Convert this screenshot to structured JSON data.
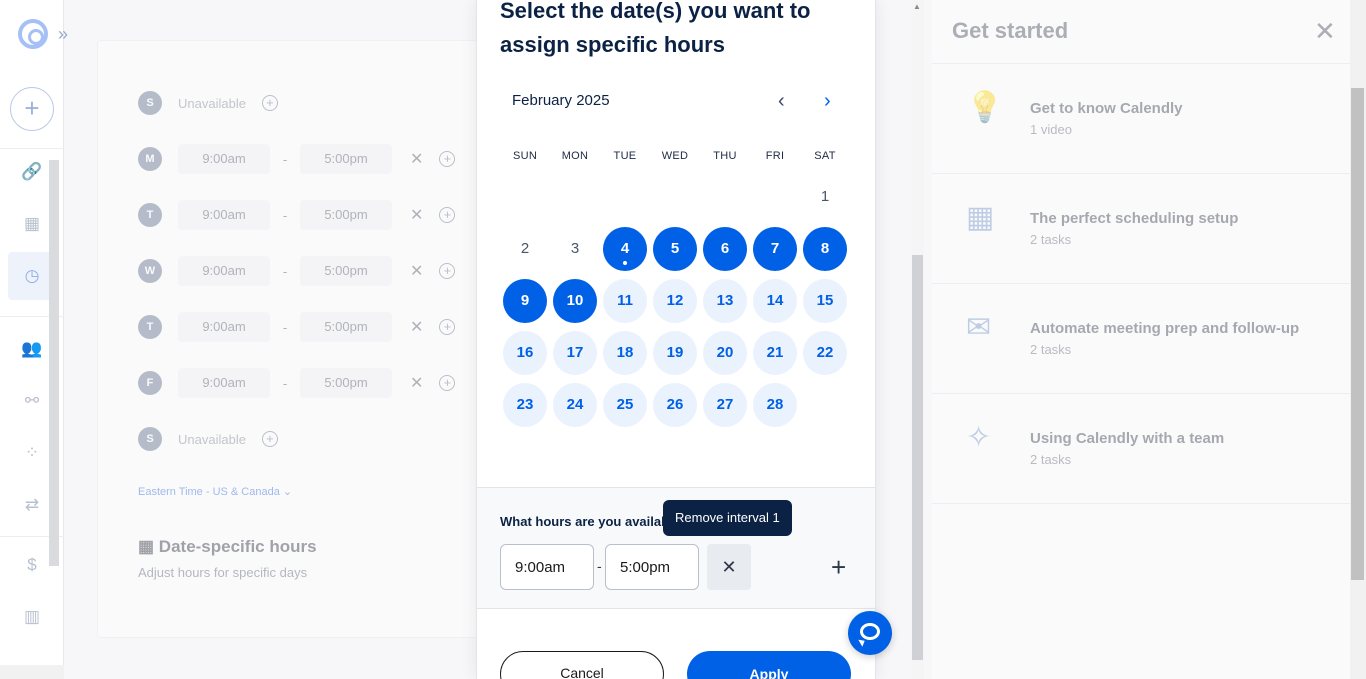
{
  "sidebar": {
    "create_label": "+",
    "items": [
      {
        "name": "scheduling-link-icon",
        "glyph": "🔗"
      },
      {
        "name": "meetings-calendar-icon",
        "glyph": "▦"
      },
      {
        "name": "availability-clock-icon",
        "glyph": "◷"
      },
      {
        "name": "contacts-icon",
        "glyph": "👥"
      },
      {
        "name": "workflows-icon",
        "glyph": "⚯"
      },
      {
        "name": "integrations-icon",
        "glyph": "⁘"
      },
      {
        "name": "routing-icon",
        "glyph": "⇄"
      },
      {
        "name": "billing-icon",
        "glyph": "$"
      },
      {
        "name": "analytics-icon",
        "glyph": "▥"
      }
    ]
  },
  "background": {
    "rows": [
      {
        "day": "S",
        "unavailable": "Unavailable"
      },
      {
        "day": "M",
        "start": "9:00am",
        "end": "5:00pm"
      },
      {
        "day": "T",
        "start": "9:00am",
        "end": "5:00pm"
      },
      {
        "day": "W",
        "start": "9:00am",
        "end": "5:00pm"
      },
      {
        "day": "T",
        "start": "9:00am",
        "end": "5:00pm"
      },
      {
        "day": "F",
        "start": "9:00am",
        "end": "5:00pm"
      },
      {
        "day": "S",
        "unavailable": "Unavailable"
      }
    ],
    "dash": "-",
    "timezone": "Eastern Time - US & Canada",
    "date_specific_title": "Date-specific hours",
    "date_specific_sub": "Adjust hours for specific days"
  },
  "modal": {
    "title": "Select the date(s) you want to assign specific hours",
    "month": "February 2025",
    "weekdays": [
      "SUN",
      "MON",
      "TUE",
      "WED",
      "THU",
      "FRI",
      "SAT"
    ],
    "days": [
      {
        "d": "1",
        "state": "plain"
      },
      {
        "d": "2",
        "state": "plain"
      },
      {
        "d": "3",
        "state": "plain"
      },
      {
        "d": "4",
        "state": "sel",
        "today": true
      },
      {
        "d": "5",
        "state": "sel"
      },
      {
        "d": "6",
        "state": "sel"
      },
      {
        "d": "7",
        "state": "sel"
      },
      {
        "d": "8",
        "state": "sel"
      },
      {
        "d": "9",
        "state": "sel"
      },
      {
        "d": "10",
        "state": "sel"
      },
      {
        "d": "11",
        "state": "avail"
      },
      {
        "d": "12",
        "state": "avail"
      },
      {
        "d": "13",
        "state": "avail"
      },
      {
        "d": "14",
        "state": "avail"
      },
      {
        "d": "15",
        "state": "avail"
      },
      {
        "d": "16",
        "state": "avail"
      },
      {
        "d": "17",
        "state": "avail"
      },
      {
        "d": "18",
        "state": "avail"
      },
      {
        "d": "19",
        "state": "avail"
      },
      {
        "d": "20",
        "state": "avail"
      },
      {
        "d": "21",
        "state": "avail"
      },
      {
        "d": "22",
        "state": "avail"
      },
      {
        "d": "23",
        "state": "avail"
      },
      {
        "d": "24",
        "state": "avail"
      },
      {
        "d": "25",
        "state": "avail"
      },
      {
        "d": "26",
        "state": "avail"
      },
      {
        "d": "27",
        "state": "avail"
      },
      {
        "d": "28",
        "state": "avail"
      }
    ],
    "hours_question": "What hours are you available?",
    "start_time": "9:00am",
    "end_time": "5:00pm",
    "dash": "-",
    "tooltip": "Remove interval 1",
    "cancel_label": "Cancel",
    "apply_label": "Apply"
  },
  "get_started": {
    "title": "Get started",
    "items": [
      {
        "name": "Get to know Calendly",
        "sub": "1 video",
        "icon": "lightbulb-icon"
      },
      {
        "name": "The perfect scheduling setup",
        "sub": "2 tasks",
        "icon": "calendar-grid-icon"
      },
      {
        "name": "Automate meeting prep and follow-up",
        "sub": "2 tasks",
        "icon": "envelopes-icon"
      },
      {
        "name": "Using Calendly with a team",
        "sub": "2 tasks",
        "icon": "team-stars-icon"
      }
    ]
  },
  "colors": {
    "primary": "#0060e6",
    "navy": "#0b2245",
    "avail_bg": "#eaf2fe"
  }
}
